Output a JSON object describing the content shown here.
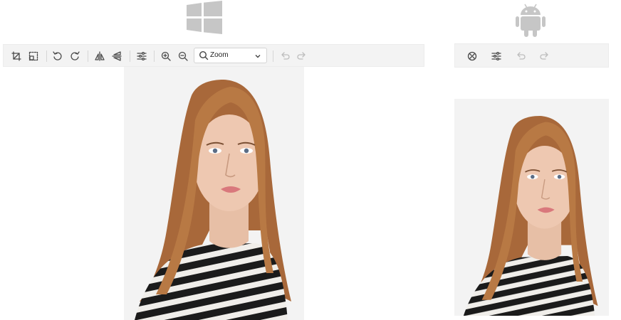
{
  "platforms": {
    "windows": {
      "logo_icon": "windows-logo-icon"
    },
    "android": {
      "logo_icon": "android-logo-icon"
    }
  },
  "windows_toolbar": {
    "buttons": [
      {
        "icon": "crop-icon",
        "enabled": true
      },
      {
        "icon": "transform-icon",
        "enabled": true
      },
      {
        "icon": "rotate-left-icon",
        "enabled": true
      },
      {
        "icon": "rotate-right-icon",
        "enabled": true
      },
      {
        "icon": "flip-horizontal-icon",
        "enabled": true
      },
      {
        "icon": "flip-vertical-icon",
        "enabled": true
      },
      {
        "icon": "adjust-sliders-icon",
        "enabled": true
      },
      {
        "icon": "zoom-in-icon",
        "enabled": true
      },
      {
        "icon": "zoom-out-icon",
        "enabled": true
      },
      {
        "icon": "undo-icon",
        "enabled": false
      },
      {
        "icon": "redo-icon",
        "enabled": false
      }
    ],
    "zoom": {
      "label": "Zoom",
      "icon": "search-icon"
    }
  },
  "android_toolbar": {
    "buttons": [
      {
        "icon": "edit-tools-icon",
        "enabled": true
      },
      {
        "icon": "adjust-sliders-icon",
        "enabled": true
      },
      {
        "icon": "undo-icon",
        "enabled": false
      },
      {
        "icon": "redo-icon",
        "enabled": false
      }
    ]
  },
  "colors": {
    "toolbar_bg": "#f3f3f3",
    "logo_gray": "#c6c6c6",
    "icon": "#4a4a4a",
    "icon_disabled": "#bdbdbd"
  }
}
